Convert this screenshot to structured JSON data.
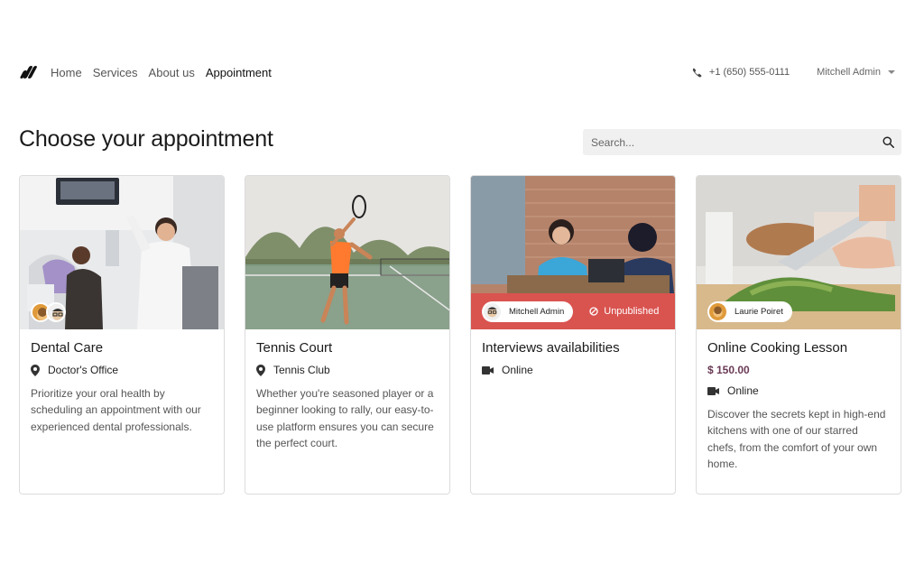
{
  "nav": {
    "links": [
      "Home",
      "Services",
      "About us",
      "Appointment"
    ],
    "phone": "+1 (650) 555-0111",
    "user": "Mitchell Admin"
  },
  "header": {
    "title": "Choose your appointment",
    "search_placeholder": "Search..."
  },
  "cards": [
    {
      "title": "Dental Care",
      "location": "Doctor's Office",
      "description": "Prioritize your oral health by scheduling an appointment with our experienced dental professionals."
    },
    {
      "title": "Tennis Court",
      "location": "Tennis Club",
      "description": "Whether you're seasoned player or a beginner looking to rally, our easy-to-use platform ensures you can secure the perfect court."
    },
    {
      "title": "Interviews availabilities",
      "location": "Online",
      "host": "Mitchell Admin",
      "status": "Unpublished"
    },
    {
      "title": "Online Cooking Lesson",
      "price": "$ 150.00",
      "location": "Online",
      "host": "Laurie Poiret",
      "description": "Discover the secrets kept in high-end kitchens with one of our starred chefs, from the comfort of your own home."
    }
  ],
  "colors": {
    "status_band": "#d9534f",
    "price": "#6a3a55"
  }
}
